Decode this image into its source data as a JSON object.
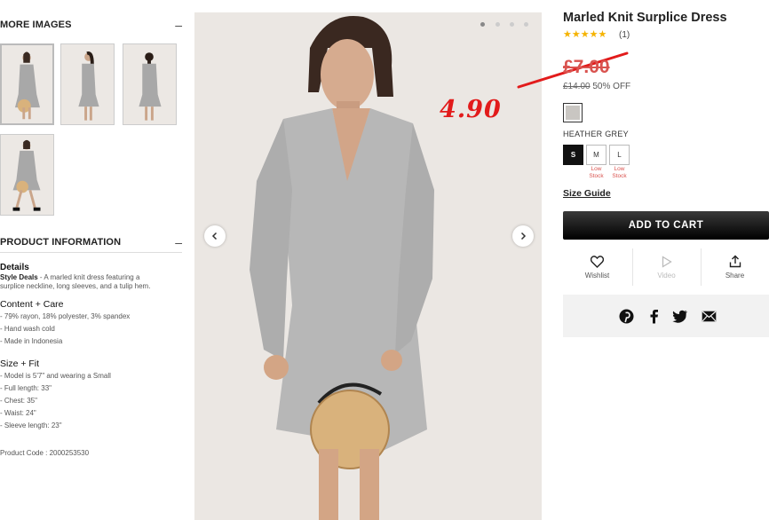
{
  "left": {
    "more_images_title": "MORE IMAGES",
    "collapse_symbol": "–",
    "product_info_title": "PRODUCT INFORMATION",
    "details_heading": "Details",
    "details_brand": "Style Deals",
    "details_text_line1": " - A marled knit dress featuring a",
    "details_text_line2": "surplice neckline, long sleeves, and a tulip hem.",
    "content_heading": "Content + Care",
    "content_items": [
      "- 79% rayon, 18% polyester, 3% spandex",
      "- Hand wash cold",
      "- Made in Indonesia"
    ],
    "size_heading": "Size + Fit",
    "size_items": [
      "- Model is 5'7\" and wearing a Small",
      "- Full length: 33\"",
      "- Chest: 35\"",
      "- Waist: 24\"",
      "- Sleeve length: 23\""
    ],
    "product_code": "Product Code : 2000253530"
  },
  "overlay": {
    "handwritten_price": "4.90"
  },
  "product": {
    "title": "Marled Knit Surplice Dress",
    "stars": "★★★★★",
    "review_count": "(1)",
    "price": "£7.00",
    "original_price": "£14.00",
    "discount": " 50% OFF",
    "color_name": "HEATHER GREY",
    "sizes": [
      {
        "label": "S",
        "selected": true,
        "note1": "",
        "note2": ""
      },
      {
        "label": "M",
        "selected": false,
        "note1": "Low",
        "note2": "Stock"
      },
      {
        "label": "L",
        "selected": false,
        "note1": "Low",
        "note2": "Stock"
      }
    ],
    "size_guide": "Size Guide",
    "add_to_cart": "ADD TO CART",
    "actions": {
      "wishlist": "Wishlist",
      "video": "Video",
      "share": "Share"
    },
    "social_icons": [
      "pinterest-icon",
      "facebook-icon",
      "twitter-icon",
      "email-icon"
    ]
  },
  "colors": {
    "accent_red": "#e21b1b",
    "cart_bg": "#000000",
    "star": "#f5b300"
  }
}
